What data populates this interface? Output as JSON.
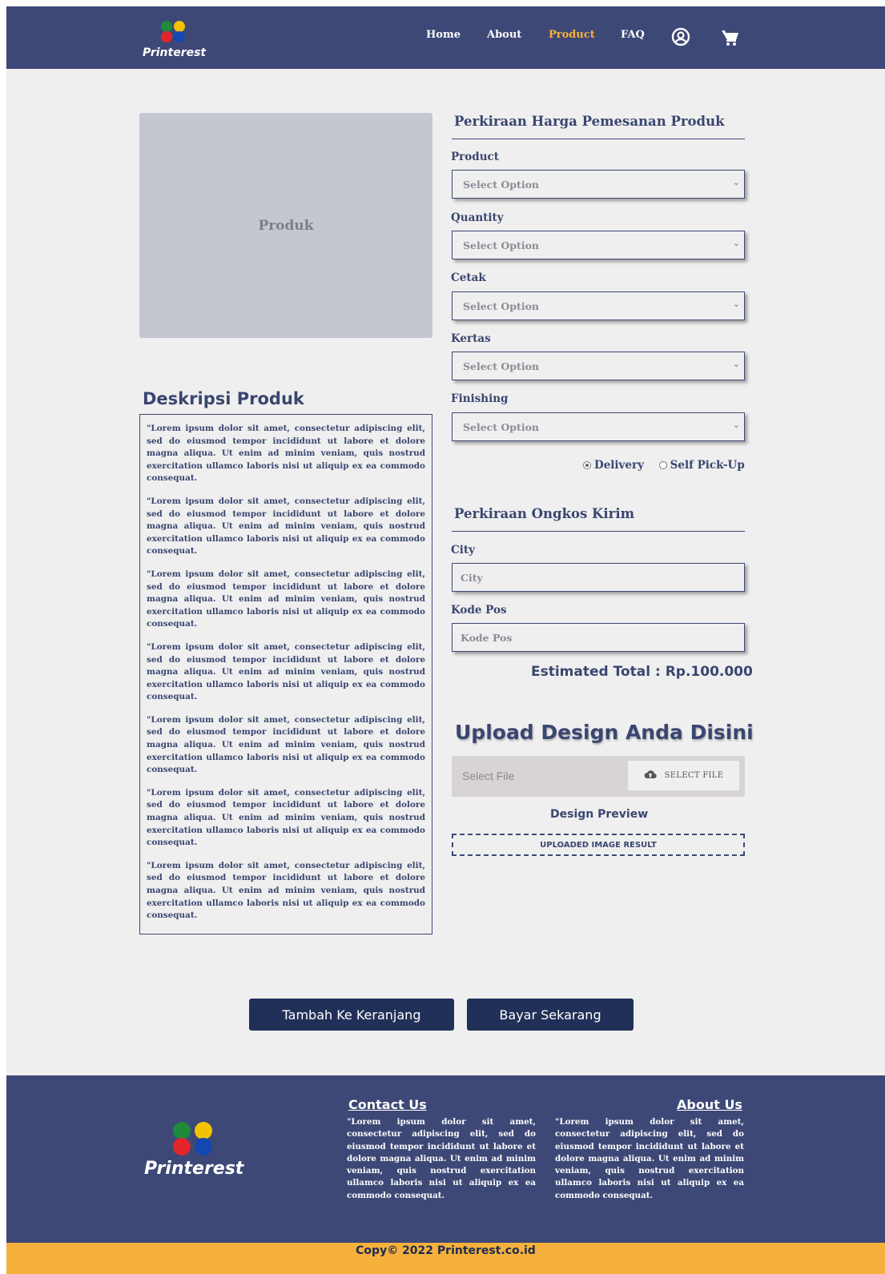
{
  "brand": {
    "name": "Printerest",
    "colors": {
      "nav": "#3d4876",
      "accent": "#f5b13c",
      "button": "#213058"
    }
  },
  "nav": {
    "links": [
      {
        "label": "Home"
      },
      {
        "label": "About"
      },
      {
        "label": "Product",
        "active": true
      },
      {
        "label": "FAQ"
      }
    ],
    "icons": [
      "user-circle-icon",
      "cart-icon"
    ]
  },
  "product": {
    "image_label": "Produk",
    "description_title": "Deskripsi Produk",
    "paragraphs": [
      "\"Lorem ipsum dolor sit amet, consectetur adipiscing elit, sed do eiusmod tempor incididunt ut labore et dolore magna aliqua. Ut enim ad minim veniam, quis nostrud exercitation ullamco laboris nisi ut aliquip ex ea commodo consequat.",
      "\"Lorem ipsum dolor sit amet, consectetur adipiscing elit, sed do eiusmod tempor incididunt ut labore et dolore magna aliqua. Ut enim ad minim veniam, quis nostrud exercitation ullamco laboris nisi ut aliquip ex ea commodo consequat.",
      "\"Lorem ipsum dolor sit amet, consectetur adipiscing elit, sed do eiusmod tempor incididunt ut labore et dolore magna aliqua. Ut enim ad minim veniam, quis nostrud exercitation ullamco laboris nisi ut aliquip ex ea commodo consequat.",
      "\"Lorem ipsum dolor sit amet, consectetur adipiscing elit, sed do eiusmod tempor incididunt ut labore et dolore magna aliqua. Ut enim ad minim veniam, quis nostrud exercitation ullamco laboris nisi ut aliquip ex ea commodo consequat.",
      "\"Lorem ipsum dolor sit amet, consectetur adipiscing elit, sed do eiusmod tempor incididunt ut labore et dolore magna aliqua. Ut enim ad minim veniam, quis nostrud exercitation ullamco laboris nisi ut aliquip ex ea commodo consequat.",
      "\"Lorem ipsum dolor sit amet, consectetur adipiscing elit, sed do eiusmod tempor incididunt ut labore et dolore magna aliqua. Ut enim ad minim veniam, quis nostrud exercitation ullamco laboris nisi ut aliquip ex ea commodo consequat.",
      "\"Lorem ipsum dolor sit amet, consectetur adipiscing elit, sed do eiusmod tempor incididunt ut labore et dolore magna aliqua. Ut enim ad minim veniam, quis nostrud exercitation ullamco laboris nisi ut aliquip ex ea commodo consequat."
    ]
  },
  "pricing": {
    "title": "Perkiraan Harga Pemesanan Produk",
    "fields": [
      {
        "label": "Product",
        "value": "Select Option"
      },
      {
        "label": "Quantity",
        "value": "Select Option"
      },
      {
        "label": "Cetak",
        "value": "Select Option"
      },
      {
        "label": "Kertas",
        "value": "Select Option"
      },
      {
        "label": "Finishing",
        "value": "Select Option"
      }
    ],
    "shipping_options": [
      {
        "label": "Delivery",
        "selected": true
      },
      {
        "label": "Self Pick-Up",
        "selected": false
      }
    ]
  },
  "shipping": {
    "title": "Perkiraan Ongkos Kirim",
    "city_label": "City",
    "city_placeholder": "City",
    "postal_label": "Kode Pos",
    "postal_placeholder": "Kode Pos",
    "estimated_total": "Estimated Total : Rp.100.000"
  },
  "upload": {
    "title": "Upload Design Anda Disini",
    "file_placeholder": "Select File",
    "button_label": "SELECT FILE",
    "preview_title": "Design Preview",
    "preview_result": "UPLOADED IMAGE RESULT"
  },
  "actions": {
    "add_to_cart": "Tambah Ke Keranjang",
    "pay_now": "Bayar Sekarang"
  },
  "footer": {
    "contact_title": "Contact Us",
    "contact_text": "\"Lorem ipsum dolor sit amet, consectetur adipiscing elit, sed do eiusmod tempor incididunt ut labore et dolore magna aliqua. Ut enim ad minim veniam, quis nostrud exercitation ullamco laboris nisi ut aliquip ex ea commodo consequat.",
    "about_title": "About Us",
    "about_text": "\"Lorem ipsum dolor sit amet, consectetur adipiscing elit, sed do eiusmod tempor incididunt ut labore et dolore magna aliqua. Ut enim ad minim veniam, quis nostrud exercitation ullamco laboris nisi ut aliquip ex ea commodo consequat.",
    "copyright": "Copy© 2022 Printerest.co.id"
  }
}
